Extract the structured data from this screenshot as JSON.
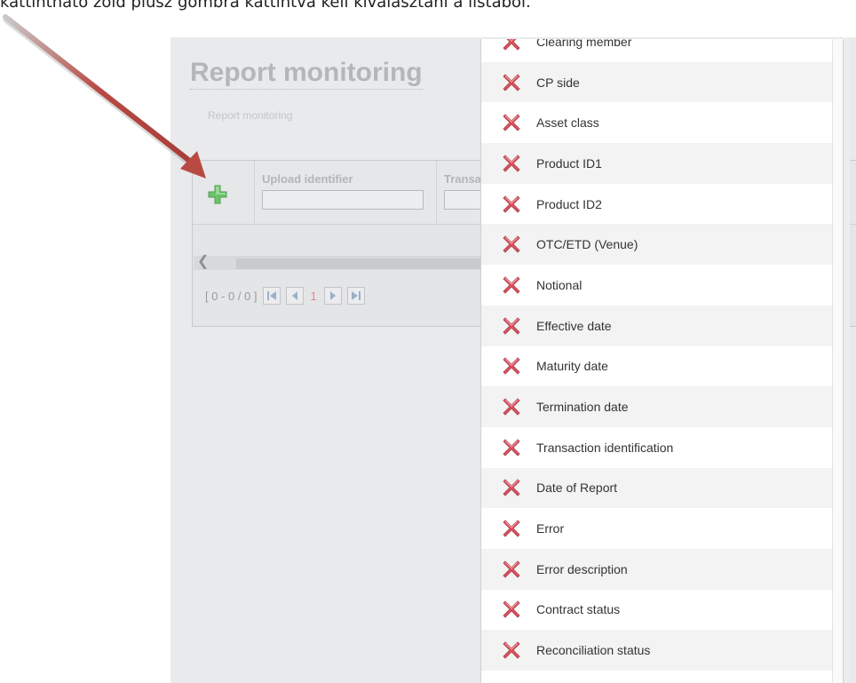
{
  "caption": "kattintható zöld plusz gombra kattintva kell kiválasztani a listából.",
  "app": {
    "title": "Report monitoring",
    "breadcrumb": "Report monitoring"
  },
  "grid": {
    "columns": [
      {
        "label": "Upload identifier",
        "value": ""
      },
      {
        "label": "Transa",
        "value": ""
      }
    ],
    "pager": {
      "range": "[ 0 - 0 / 0 ]",
      "current_page": "1"
    }
  },
  "column_list": {
    "items": [
      {
        "label": "Clearing member",
        "icon": "remove-icon"
      },
      {
        "label": "CP side",
        "icon": "remove-icon"
      },
      {
        "label": "Asset class",
        "icon": "remove-icon"
      },
      {
        "label": "Product ID1",
        "icon": "remove-icon"
      },
      {
        "label": "Product ID2",
        "icon": "remove-icon"
      },
      {
        "label": "OTC/ETD (Venue)",
        "icon": "remove-icon"
      },
      {
        "label": "Notional",
        "icon": "remove-icon"
      },
      {
        "label": "Effective date",
        "icon": "remove-icon"
      },
      {
        "label": "Maturity date",
        "icon": "remove-icon"
      },
      {
        "label": "Termination date",
        "icon": "remove-icon"
      },
      {
        "label": "Transaction identification",
        "icon": "remove-icon"
      },
      {
        "label": "Date of Report",
        "icon": "remove-icon"
      },
      {
        "label": "Error",
        "icon": "remove-icon"
      },
      {
        "label": "Error description",
        "icon": "remove-icon"
      },
      {
        "label": "Contract status",
        "icon": "remove-icon"
      },
      {
        "label": "Reconciliation status",
        "icon": "remove-icon"
      }
    ]
  },
  "colors": {
    "add_icon": "#6cc36b",
    "remove_icon": "#d9535f",
    "arrow": "#b84a43",
    "page_number": "#e98484"
  }
}
